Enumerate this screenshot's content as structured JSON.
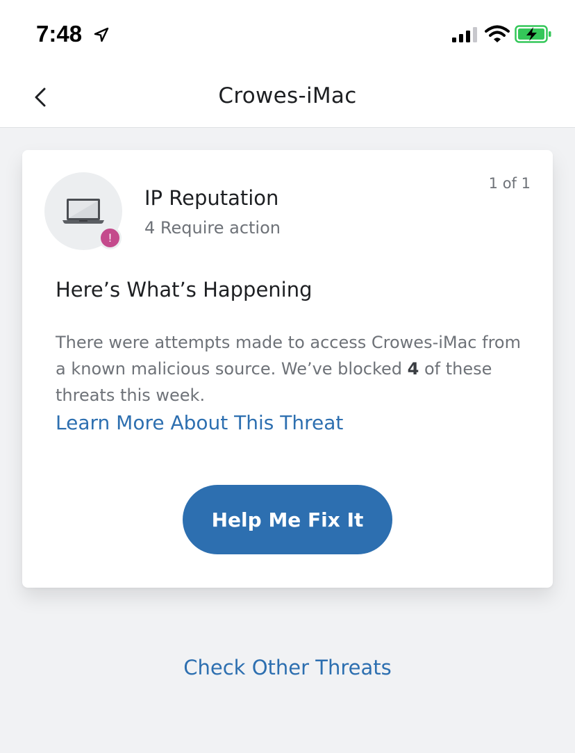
{
  "status_bar": {
    "time": "7:48",
    "icons": [
      "location-arrow-icon",
      "cellular-signal-icon",
      "wifi-icon",
      "battery-charging-icon"
    ]
  },
  "nav": {
    "title": "Crowes-iMac",
    "back_icon": "chevron-left-icon"
  },
  "card": {
    "device_icon": "laptop-icon",
    "badge_text": "!",
    "title": "IP Reputation",
    "subtitle": "4 Require action",
    "pager": "1 of 1",
    "heading": "Here’s What’s Happening",
    "description_before": "There were attempts made to access Crowes-iMac from a known malicious source. We’ve blocked ",
    "description_count": "4",
    "description_after": " of these threats this week.",
    "learn_more_link": "Learn More About This Threat",
    "action_button": "Help Me Fix It"
  },
  "footer": {
    "check_other_link": "Check Other Threats"
  },
  "colors": {
    "accent": "#2d6fb0",
    "badge": "#c44a8c",
    "battery": "#34c759",
    "background": "#f1f2f4"
  }
}
